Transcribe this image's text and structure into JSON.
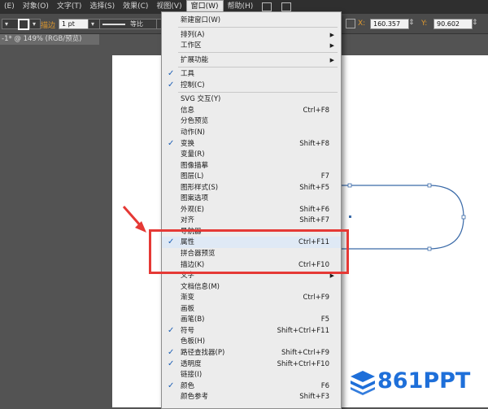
{
  "menubar": {
    "items": [
      "(E)",
      "对象(O)",
      "文字(T)",
      "选择(S)",
      "效果(C)",
      "视图(V)",
      "窗口(W)",
      "帮助(H)"
    ]
  },
  "control": {
    "stroke_label": "描边",
    "stroke_weight": "1 pt",
    "profile_label": "等比",
    "x_label": "X:",
    "x_value": "160.357",
    "y_label": "Y:",
    "y_value": "90.602"
  },
  "doc_tab": "-1* @ 149% (RGB/预览)",
  "menu": {
    "items": [
      {
        "label": "新建窗口(W)",
        "checked": false,
        "shortcut": "",
        "submenu": false
      },
      {
        "sep": true
      },
      {
        "label": "排列(A)",
        "checked": false,
        "shortcut": "",
        "submenu": true
      },
      {
        "label": "工作区",
        "checked": false,
        "shortcut": "",
        "submenu": true
      },
      {
        "sep": true
      },
      {
        "label": "扩展功能",
        "checked": false,
        "shortcut": "",
        "submenu": true
      },
      {
        "sep": true
      },
      {
        "label": "工具",
        "checked": true,
        "shortcut": "",
        "submenu": false
      },
      {
        "label": "控制(C)",
        "checked": true,
        "shortcut": "",
        "submenu": false
      },
      {
        "sep": true
      },
      {
        "label": "SVG 交互(Y)",
        "checked": false,
        "shortcut": "",
        "submenu": false
      },
      {
        "label": "信息",
        "checked": false,
        "shortcut": "Ctrl+F8",
        "submenu": false
      },
      {
        "label": "分色预览",
        "checked": false,
        "shortcut": "",
        "submenu": false
      },
      {
        "label": "动作(N)",
        "checked": false,
        "shortcut": "",
        "submenu": false
      },
      {
        "label": "变换",
        "checked": true,
        "shortcut": "Shift+F8",
        "submenu": false
      },
      {
        "label": "变量(R)",
        "checked": false,
        "shortcut": "",
        "submenu": false
      },
      {
        "label": "图像描摹",
        "checked": false,
        "shortcut": "",
        "submenu": false
      },
      {
        "label": "图层(L)",
        "checked": false,
        "shortcut": "F7",
        "submenu": false
      },
      {
        "label": "图形样式(S)",
        "checked": false,
        "shortcut": "Shift+F5",
        "submenu": false
      },
      {
        "label": "图案选项",
        "checked": false,
        "shortcut": "",
        "submenu": false
      },
      {
        "label": "外观(E)",
        "checked": false,
        "shortcut": "Shift+F6",
        "submenu": false
      },
      {
        "label": "对齐",
        "checked": false,
        "shortcut": "Shift+F7",
        "submenu": false
      },
      {
        "label": "导航器",
        "checked": false,
        "shortcut": "",
        "submenu": false
      },
      {
        "label": "属性",
        "checked": true,
        "shortcut": "Ctrl+F11",
        "submenu": false,
        "highlight": true
      },
      {
        "label": "拼合器预览",
        "checked": false,
        "shortcut": "",
        "submenu": false
      },
      {
        "label": "描边(K)",
        "checked": false,
        "shortcut": "Ctrl+F10",
        "submenu": false
      },
      {
        "label": "文字",
        "checked": false,
        "shortcut": "",
        "submenu": true
      },
      {
        "label": "文档信息(M)",
        "checked": false,
        "shortcut": "",
        "submenu": false
      },
      {
        "label": "渐变",
        "checked": false,
        "shortcut": "Ctrl+F9",
        "submenu": false
      },
      {
        "label": "画板",
        "checked": false,
        "shortcut": "",
        "submenu": false
      },
      {
        "label": "画笔(B)",
        "checked": false,
        "shortcut": "F5",
        "submenu": false
      },
      {
        "label": "符号",
        "checked": true,
        "shortcut": "Shift+Ctrl+F11",
        "submenu": false
      },
      {
        "label": "色板(H)",
        "checked": false,
        "shortcut": "",
        "submenu": false
      },
      {
        "label": "路径查找器(P)",
        "checked": true,
        "shortcut": "Shift+Ctrl+F9",
        "submenu": false
      },
      {
        "label": "透明度",
        "checked": true,
        "shortcut": "Shift+Ctrl+F10",
        "submenu": false
      },
      {
        "label": "链接(I)",
        "checked": false,
        "shortcut": "",
        "submenu": false
      },
      {
        "label": "颜色",
        "checked": true,
        "shortcut": "F6",
        "submenu": false
      },
      {
        "label": "颜色参考",
        "checked": false,
        "shortcut": "Shift+F3",
        "submenu": false
      }
    ]
  },
  "watermark": "861PPT",
  "colors": {
    "annotation": "#e53935",
    "check": "#1d5fb5",
    "watermark": "#1e6fd9"
  }
}
